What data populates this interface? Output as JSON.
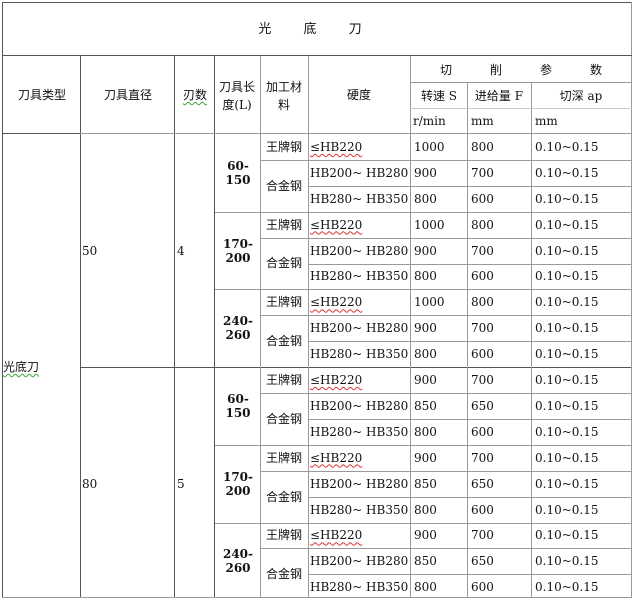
{
  "title": "光 底 刀",
  "headers": {
    "tool_type": "刀具类型",
    "tool_diameter": "刀具直径",
    "flutes": "刃数",
    "tool_length": "刀具长度(L)",
    "material": "加工材料",
    "hardness": "硬度",
    "cutting_params": [
      "切",
      "削",
      "参",
      "数"
    ],
    "speed": "转速 S",
    "feed": "进给量 F",
    "depth": "切深 ap",
    "speed_unit": "r/min",
    "feed_unit": "mm",
    "depth_unit": "mm"
  },
  "tool_type_value": "光底刀",
  "groups": [
    {
      "diameter": "50",
      "flutes": "4",
      "lengths": [
        {
          "length": "60-150",
          "rows": [
            {
              "material": "王牌钢",
              "hardness": "≤HB220",
              "speed": "1000",
              "feed": "800",
              "depth": "0.10~0.15"
            },
            {
              "material": "合金钢",
              "hardness": "HB200~ HB280",
              "speed": "900",
              "feed": "700",
              "depth": "0.10~0.15"
            },
            {
              "material": "",
              "hardness": "HB280~ HB350",
              "speed": "800",
              "feed": "600",
              "depth": "0.10~0.15"
            }
          ]
        },
        {
          "length": "170-200",
          "rows": [
            {
              "material": "王牌钢",
              "hardness": "≤HB220",
              "speed": "1000",
              "feed": "800",
              "depth": "0.10~0.15"
            },
            {
              "material": "合金钢",
              "hardness": "HB200~ HB280",
              "speed": "900",
              "feed": "700",
              "depth": "0.10~0.15"
            },
            {
              "material": "",
              "hardness": "HB280~ HB350",
              "speed": "800",
              "feed": "600",
              "depth": "0.10~0.15"
            }
          ]
        },
        {
          "length": "240-260",
          "rows": [
            {
              "material": "王牌钢",
              "hardness": "≤HB220",
              "speed": "1000",
              "feed": "800",
              "depth": "0.10~0.15"
            },
            {
              "material": "合金钢",
              "hardness": "HB200~ HB280",
              "speed": "900",
              "feed": "700",
              "depth": "0.10~0.15"
            },
            {
              "material": "",
              "hardness": "HB280~ HB350",
              "speed": "800",
              "feed": "600",
              "depth": "0.10~0.15"
            }
          ]
        }
      ]
    },
    {
      "diameter": "80",
      "flutes": "5",
      "lengths": [
        {
          "length": "60-150",
          "rows": [
            {
              "material": "王牌钢",
              "hardness": "≤HB220",
              "speed": "900",
              "feed": "700",
              "depth": "0.10~0.15"
            },
            {
              "material": "合金钢",
              "hardness": "HB200~ HB280",
              "speed": "850",
              "feed": "650",
              "depth": "0.10~0.15"
            },
            {
              "material": "",
              "hardness": "HB280~ HB350",
              "speed": "800",
              "feed": "600",
              "depth": "0.10~0.15"
            }
          ]
        },
        {
          "length": "170-200",
          "rows": [
            {
              "material": "王牌钢",
              "hardness": "≤HB220",
              "speed": "900",
              "feed": "700",
              "depth": "0.10~0.15"
            },
            {
              "material": "合金钢",
              "hardness": "HB200~ HB280",
              "speed": "850",
              "feed": "650",
              "depth": "0.10~0.15"
            },
            {
              "material": "",
              "hardness": "HB280~ HB350",
              "speed": "800",
              "feed": "600",
              "depth": "0.10~0.15"
            }
          ]
        },
        {
          "length": "240-260",
          "rows": [
            {
              "material": "王牌钢",
              "hardness": "≤HB220",
              "speed": "900",
              "feed": "700",
              "depth": "0.10~0.15"
            },
            {
              "material": "合金钢",
              "hardness": "HB200~ HB280",
              "speed": "850",
              "feed": "650",
              "depth": "0.10~0.15"
            },
            {
              "material": "",
              "hardness": "HB280~ HB350",
              "speed": "800",
              "feed": "600",
              "depth": "0.10~0.15"
            }
          ]
        }
      ]
    }
  ]
}
